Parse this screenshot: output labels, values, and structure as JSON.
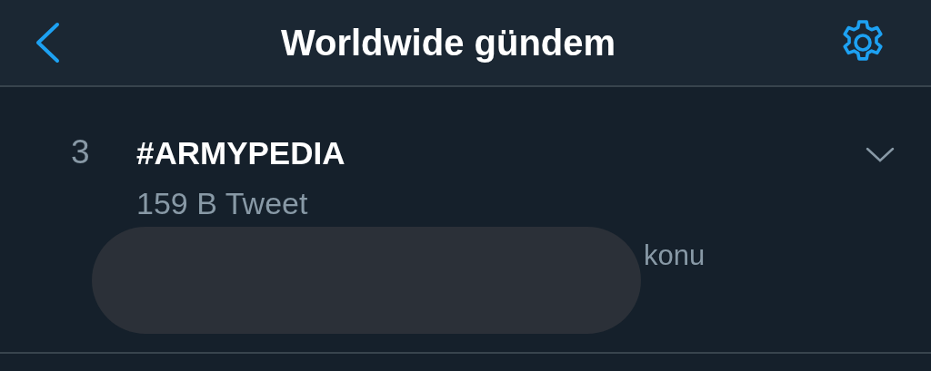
{
  "header": {
    "title": "Worldwide gündem"
  },
  "trends": [
    {
      "rank": "3",
      "name": "#ARMYPEDIA",
      "count": "159 B Tweet",
      "context_visible": "konu"
    }
  ]
}
